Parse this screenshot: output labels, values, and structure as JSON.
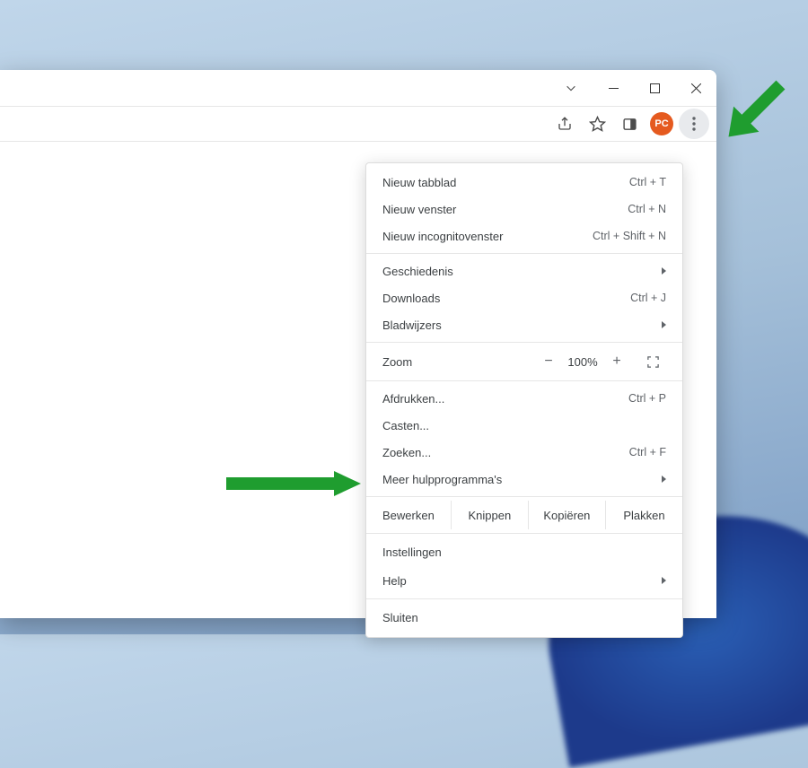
{
  "avatar": "PC",
  "menu": {
    "new_tab": {
      "label": "Nieuw tabblad",
      "shortcut": "Ctrl + T"
    },
    "new_window": {
      "label": "Nieuw venster",
      "shortcut": "Ctrl + N"
    },
    "new_incognito": {
      "label": "Nieuw incognitovenster",
      "shortcut": "Ctrl + Shift + N"
    },
    "history": {
      "label": "Geschiedenis"
    },
    "downloads": {
      "label": "Downloads",
      "shortcut": "Ctrl + J"
    },
    "bookmarks": {
      "label": "Bladwijzers"
    },
    "zoom": {
      "label": "Zoom",
      "minus": "−",
      "value": "100%",
      "plus": "+"
    },
    "print": {
      "label": "Afdrukken...",
      "shortcut": "Ctrl + P"
    },
    "cast": {
      "label": "Casten..."
    },
    "find": {
      "label": "Zoeken...",
      "shortcut": "Ctrl + F"
    },
    "more_tools": {
      "label": "Meer hulpprogramma's"
    },
    "edit": {
      "label": "Bewerken",
      "cut": "Knippen",
      "copy": "Kopiëren",
      "paste": "Plakken"
    },
    "settings": {
      "label": "Instellingen"
    },
    "help": {
      "label": "Help"
    },
    "exit": {
      "label": "Sluiten"
    }
  }
}
